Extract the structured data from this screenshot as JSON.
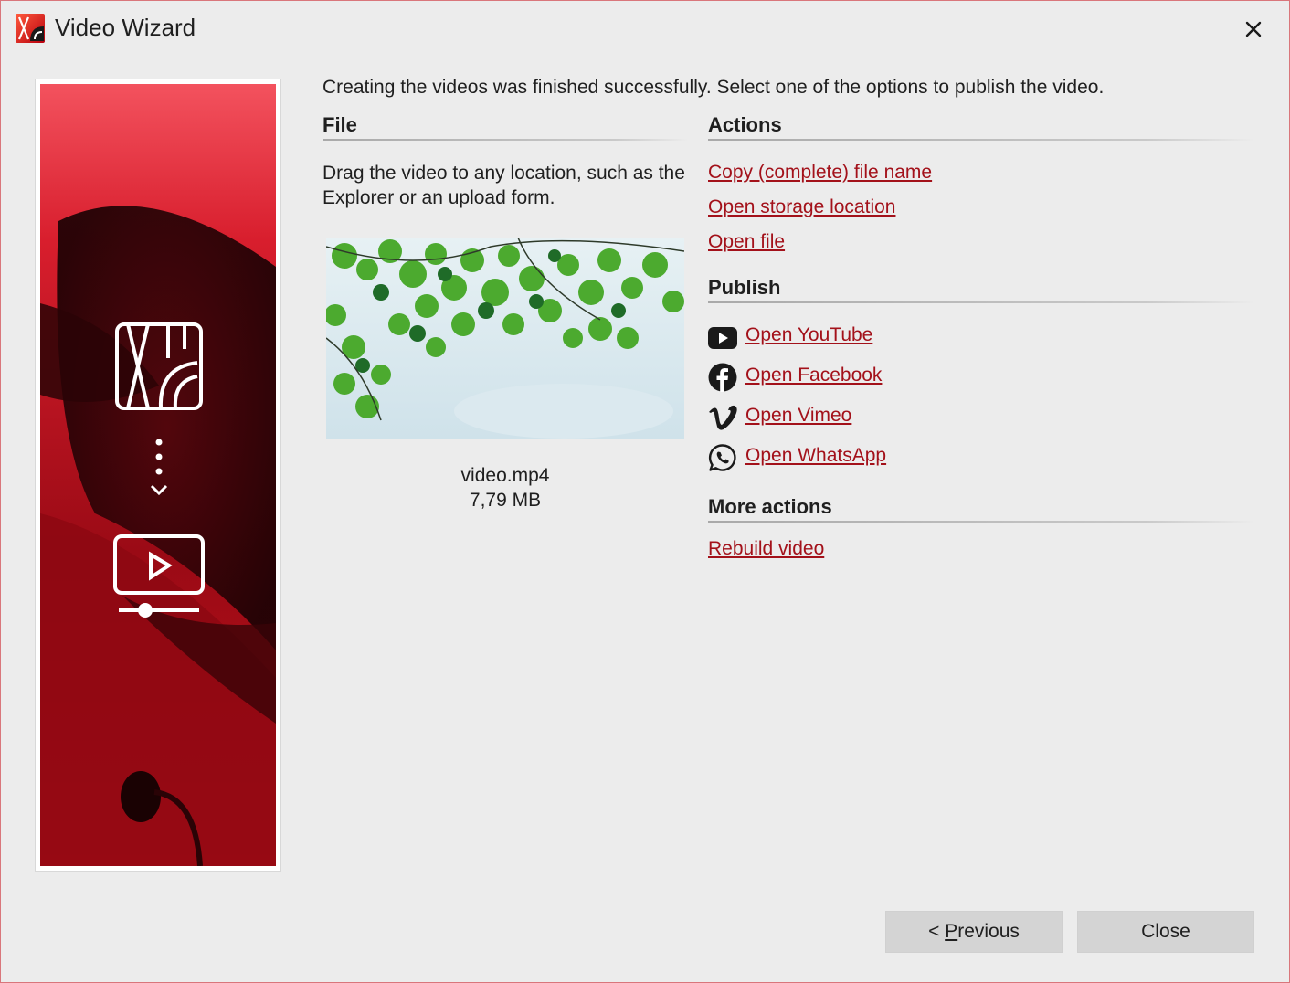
{
  "window": {
    "title": "Video Wizard",
    "close_icon": "close-icon",
    "app_icon": "app-logo-icon"
  },
  "banner": {
    "icons": [
      "slideshow-logo-icon",
      "dotted-arrow-down-icon",
      "video-player-icon"
    ],
    "colors": {
      "primary": "#c0101c",
      "dark": "#2a0306",
      "light": "#f3525e"
    }
  },
  "intro": "Creating the videos was finished successfully. Select one of the options to publish the video.",
  "file": {
    "heading": "File",
    "description": "Drag the video to any location, such as the Explorer or an upload form.",
    "thumbnail": "green-leaves-sky-thumbnail",
    "name": "video.mp4",
    "size": "7,79 MB"
  },
  "actions": {
    "heading": "Actions",
    "items": [
      {
        "label": "Copy (complete) file name"
      },
      {
        "label": "Open storage location"
      },
      {
        "label": "Open file"
      }
    ]
  },
  "publish": {
    "heading": "Publish",
    "items": [
      {
        "label": "Open YouTube",
        "icon": "youtube-icon"
      },
      {
        "label": "Open Facebook",
        "icon": "facebook-icon"
      },
      {
        "label": "Open Vimeo",
        "icon": "vimeo-icon"
      },
      {
        "label": "Open WhatsApp",
        "icon": "whatsapp-icon"
      }
    ]
  },
  "more_actions": {
    "heading": "More actions",
    "items": [
      {
        "label": "Rebuild video"
      }
    ]
  },
  "buttons": {
    "previous_prefix": "< ",
    "previous_mnemonic": "P",
    "previous_rest": "revious",
    "close": "Close"
  },
  "colors": {
    "link": "#a3111a",
    "background": "#ececec",
    "button": "#d4d4d4",
    "window_border": "#d9767b"
  }
}
